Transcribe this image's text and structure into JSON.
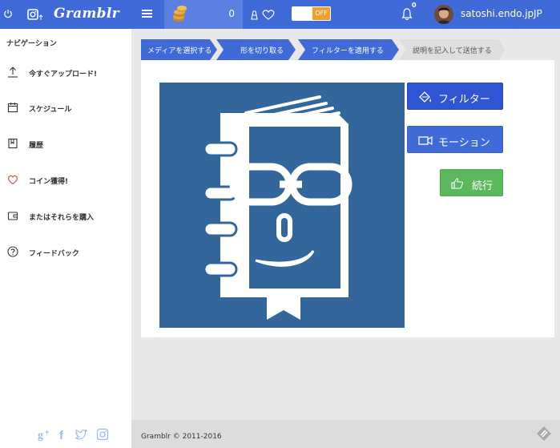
{
  "header": {
    "brand": "Gramblr",
    "coin_count": "0",
    "toggle_label": "OFF",
    "notification_count": "0",
    "username": "satoshi.endo.jp",
    "language": "JP"
  },
  "sidebar": {
    "title": "ナビゲーション",
    "items": [
      {
        "label": "今すぐアップロード!",
        "icon": "upload-icon"
      },
      {
        "label": "スケジュール",
        "icon": "calendar-icon"
      },
      {
        "label": "履歴",
        "icon": "bookmark-icon"
      },
      {
        "label": "コイン獲得!",
        "icon": "heart-icon"
      },
      {
        "label": "またはそれらを購入",
        "icon": "wallet-icon"
      },
      {
        "label": "フィードバック",
        "icon": "question-icon"
      }
    ],
    "social": [
      "google-plus-icon",
      "facebook-icon",
      "twitter-icon",
      "instagram-icon"
    ]
  },
  "steps": [
    {
      "label": "メディアを選択する",
      "active": true
    },
    {
      "label": "形を切り取る",
      "active": true
    },
    {
      "label": "フィルターを適用する",
      "active": true
    },
    {
      "label": "説明を記入して送信する",
      "active": false
    }
  ],
  "buttons": {
    "filter": "フィルター",
    "motion": "モーション",
    "continue": "続行"
  },
  "footer": {
    "copyright": "Gramblr © 2011-2016"
  },
  "colors": {
    "primary": "#3f6ad8",
    "filter_button": "#2f55d4",
    "continue_button": "#5cb85c",
    "image_background": "#33669a",
    "toggle_off": "#f0a030"
  }
}
